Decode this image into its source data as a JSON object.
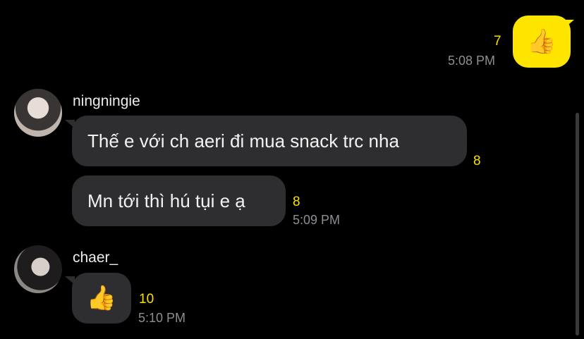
{
  "messages": {
    "sent": {
      "emoji": "👍",
      "unread_count": "7",
      "time": "5:08 PM"
    },
    "group_ningningie": {
      "sender": "ningningie",
      "items": [
        {
          "text": "Thế e với ch aeri đi mua snack trc nha",
          "unread_count": "8"
        },
        {
          "text": "Mn tới thì hú tụi e ạ",
          "unread_count": "8",
          "time": "5:09 PM"
        }
      ]
    },
    "group_chaer": {
      "sender": "chaer_",
      "emoji": "👍",
      "unread_count": "10",
      "time": "5:10 PM"
    }
  },
  "colors": {
    "background": "#000000",
    "sent_bubble": "#fee500",
    "received_bubble": "#2e2e30",
    "unread_count": "#f9e000",
    "timestamp": "#8e8e93"
  },
  "icons": [
    "thumbs-up-icon",
    "avatar"
  ]
}
